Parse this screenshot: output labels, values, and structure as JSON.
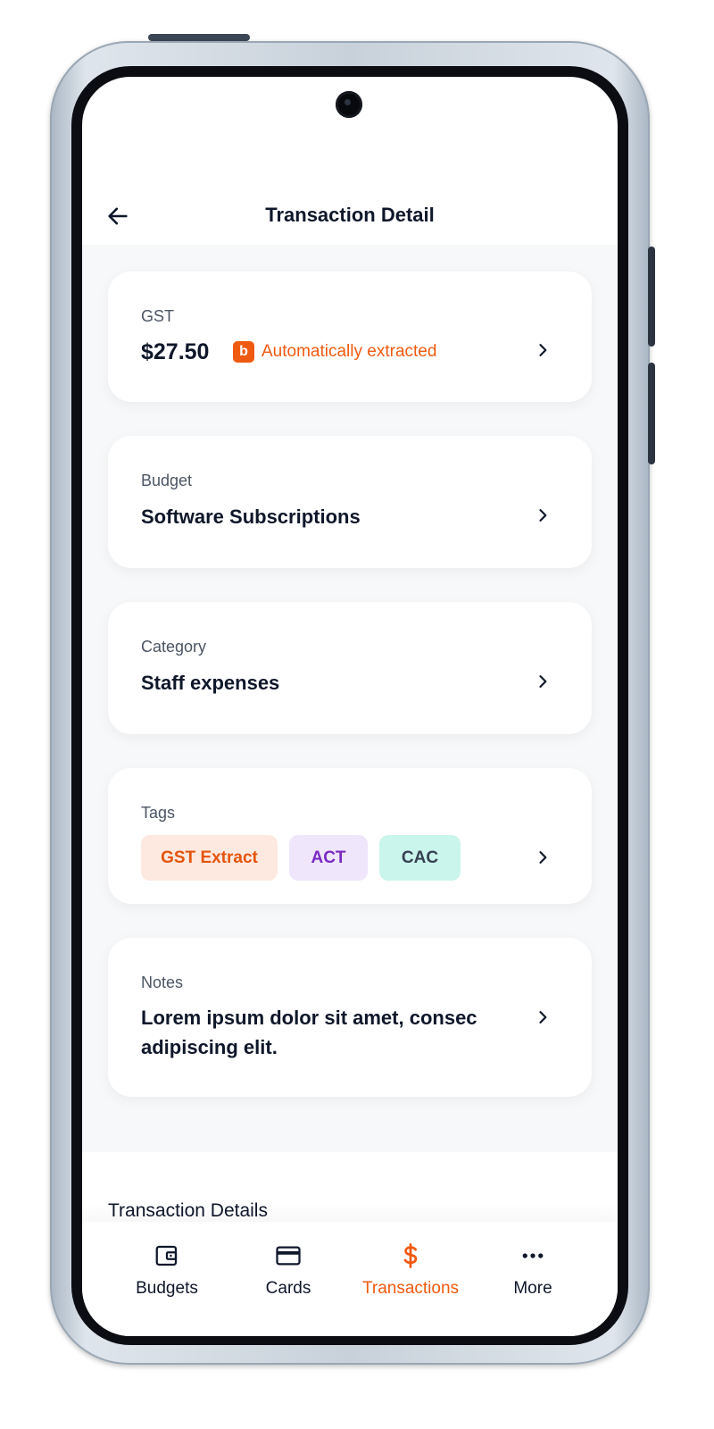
{
  "header": {
    "title": "Transaction Detail"
  },
  "gst": {
    "label": "GST",
    "amount": "$27.50",
    "badge_icon": "b",
    "badge_text": "Automatically extracted"
  },
  "budget": {
    "label": "Budget",
    "value": "Software Subscriptions"
  },
  "category": {
    "label": "Category",
    "value": "Staff expenses"
  },
  "tags": {
    "label": "Tags",
    "items": [
      {
        "text": "GST Extract",
        "bg": "#fde9df",
        "color": "#e5540c"
      },
      {
        "text": "ACT",
        "bg": "#efe6fb",
        "color": "#7a2bc4"
      },
      {
        "text": "CAC",
        "bg": "#c9f5ec",
        "color": "#374151"
      }
    ]
  },
  "notes": {
    "label": "Notes",
    "text": "Lorem ipsum dolor sit amet, consec adipiscing elit."
  },
  "section": {
    "title": "Transaction Details"
  },
  "nav": {
    "items": [
      {
        "label": "Budgets",
        "icon": "wallet-icon"
      },
      {
        "label": "Cards",
        "icon": "card-icon"
      },
      {
        "label": "Transactions",
        "icon": "dollar-icon",
        "active": true
      },
      {
        "label": "More",
        "icon": "more-icon"
      }
    ]
  },
  "colors": {
    "accent": "#f05a10",
    "text": "#0f172a",
    "muted": "#4b5563",
    "background": "#f7f8f9"
  }
}
